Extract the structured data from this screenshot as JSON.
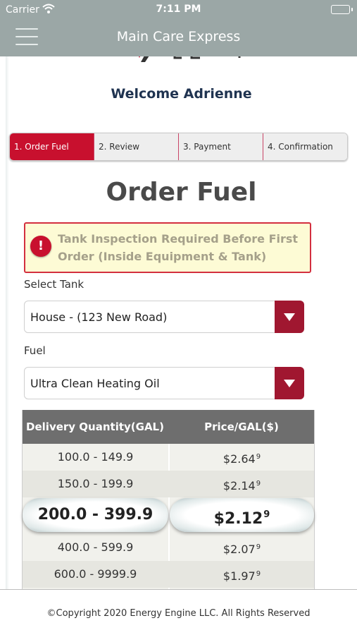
{
  "status_bar": {
    "carrier": "Carrier",
    "time": "7:11 PM"
  },
  "header": {
    "title": "Main Care Express",
    "menu_icon": "hamburger-menu-icon"
  },
  "welcome": "Welcome Adrienne",
  "steps": [
    {
      "label": "1. Order Fuel",
      "active": true
    },
    {
      "label": "2. Review",
      "active": false
    },
    {
      "label": "3. Payment",
      "active": false
    },
    {
      "label": "4. Confirmation",
      "active": false
    }
  ],
  "page_title": "Order Fuel",
  "alert": {
    "icon": "exclamation-icon",
    "text": "Tank Inspection Required Before First Order (Inside Equipment & Tank)"
  },
  "tank": {
    "label": "Select Tank",
    "value": "House - (123 New Road)"
  },
  "fuel": {
    "label": "Fuel",
    "value": "Ultra Clean Heating Oil"
  },
  "price_table": {
    "headers": {
      "quantity": "Delivery Quantity(GAL)",
      "price": "Price/GAL($)"
    },
    "rows": [
      {
        "quantity": "100.0 - 149.9",
        "price": "$2.64",
        "price_sup": "9"
      },
      {
        "quantity": "150.0 - 199.9",
        "price": "$2.14",
        "price_sup": "9"
      },
      {
        "quantity": "200.0 - 399.9",
        "price": "$2.12",
        "price_sup": "9",
        "selected": true
      },
      {
        "quantity": "400.0 - 599.9",
        "price": "$2.07",
        "price_sup": "9"
      },
      {
        "quantity": "600.0 - 9999.9",
        "price": "$1.97",
        "price_sup": "9"
      }
    ]
  },
  "footer": "©Copyright 2020 Energy Engine LLC. All Rights Reserved",
  "colors": {
    "brand_red": "#c8102e",
    "header_gray": "#9ba7a6",
    "title_navy": "#1f3350"
  }
}
